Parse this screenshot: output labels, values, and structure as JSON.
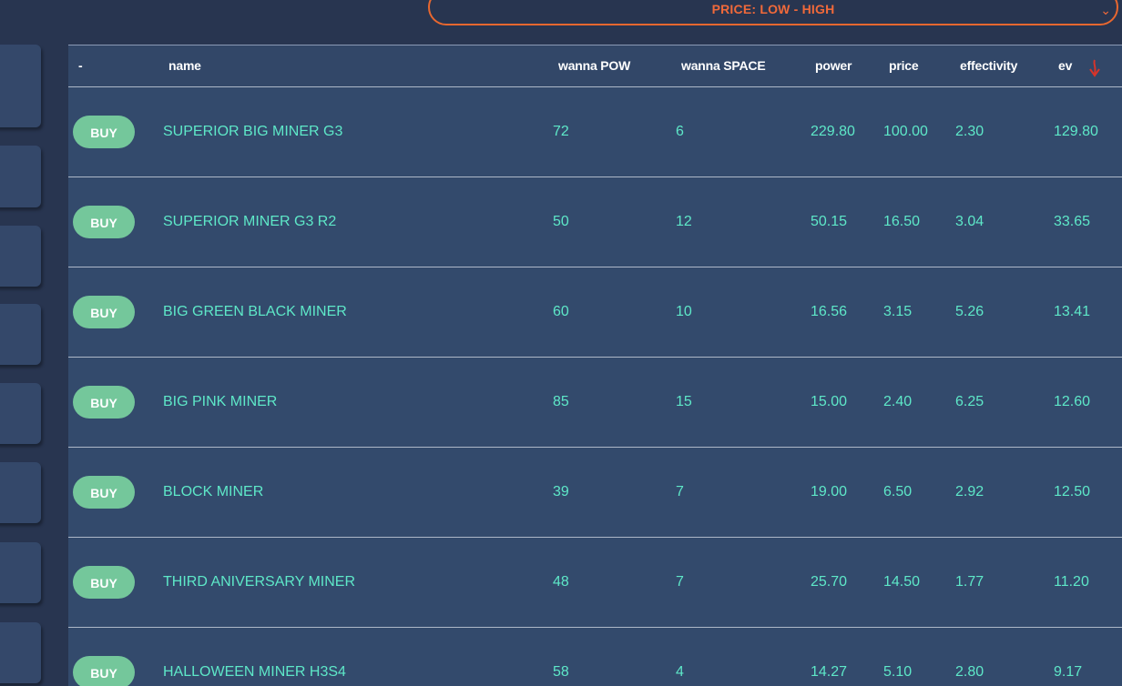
{
  "sort": {
    "selected": "PRICE: LOW - HIGH"
  },
  "table": {
    "headers": {
      "action": "-",
      "name": "name",
      "wanna_pow": "wanna POW",
      "wanna_space": "wanna SPACE",
      "power": "power",
      "price": "price",
      "effectivity": "effectivity",
      "ev": "ev"
    },
    "sort_indicator": {
      "column": "ev",
      "direction": "descending",
      "color": "#d8342a"
    },
    "buy_label": "BUY",
    "rows": [
      {
        "name": "SUPERIOR BIG MINER G3",
        "wanna_pow": "72",
        "wanna_space": "6",
        "power": "229.80",
        "price": "100.00",
        "effectivity": "2.30",
        "ev": "129.80"
      },
      {
        "name": "SUPERIOR MINER G3 R2",
        "wanna_pow": "50",
        "wanna_space": "12",
        "power": "50.15",
        "price": "16.50",
        "effectivity": "3.04",
        "ev": "33.65"
      },
      {
        "name": "BIG GREEN BLACK MINER",
        "wanna_pow": "60",
        "wanna_space": "10",
        "power": "16.56",
        "price": "3.15",
        "effectivity": "5.26",
        "ev": "13.41"
      },
      {
        "name": "BIG PINK MINER",
        "wanna_pow": "85",
        "wanna_space": "15",
        "power": "15.00",
        "price": "2.40",
        "effectivity": "6.25",
        "ev": "12.60"
      },
      {
        "name": "BLOCK MINER",
        "wanna_pow": "39",
        "wanna_space": "7",
        "power": "19.00",
        "price": "6.50",
        "effectivity": "2.92",
        "ev": "12.50"
      },
      {
        "name": "THIRD ANIVERSARY MINER",
        "wanna_pow": "48",
        "wanna_space": "7",
        "power": "25.70",
        "price": "14.50",
        "effectivity": "1.77",
        "ev": "11.20"
      },
      {
        "name": "HALLOWEEN MINER H3S4",
        "wanna_pow": "58",
        "wanna_space": "4",
        "power": "14.27",
        "price": "5.10",
        "effectivity": "2.80",
        "ev": "9.17"
      }
    ]
  },
  "colors": {
    "background": "#283550",
    "table_bg": "#334a6c",
    "accent_orange": "#e8672f",
    "buy_button": "#74c79b",
    "cell_text": "#5ee8c8",
    "header_text": "#ffffff"
  }
}
